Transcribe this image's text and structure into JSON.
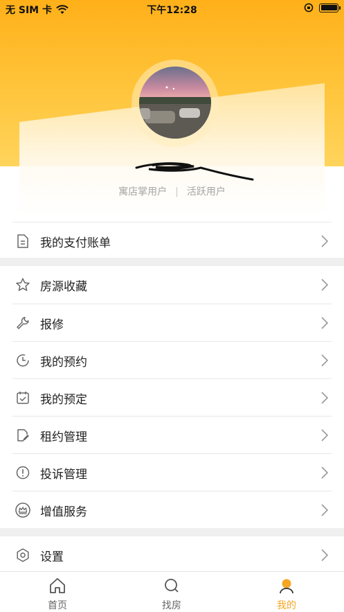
{
  "status_bar": {
    "carrier": "无 SIM 卡",
    "time": "下午12:28"
  },
  "profile": {
    "tag_primary": "寓店掌用户",
    "tag_separator": "|",
    "tag_secondary": "活跃用户"
  },
  "menu": {
    "payment": "我的支付账单",
    "favorites": "房源收藏",
    "repair": "报修",
    "appointments": "我的预约",
    "reservations": "我的预定",
    "lease": "租约管理",
    "complaints": "投诉管理",
    "value_added": "增值服务",
    "settings": "设置"
  },
  "tabbar": {
    "home": "首页",
    "find": "找房",
    "mine": "我的",
    "active_color": "#f5a623"
  },
  "colors": {
    "header_top": "#ffb019",
    "header_bottom": "#ffd45c"
  }
}
